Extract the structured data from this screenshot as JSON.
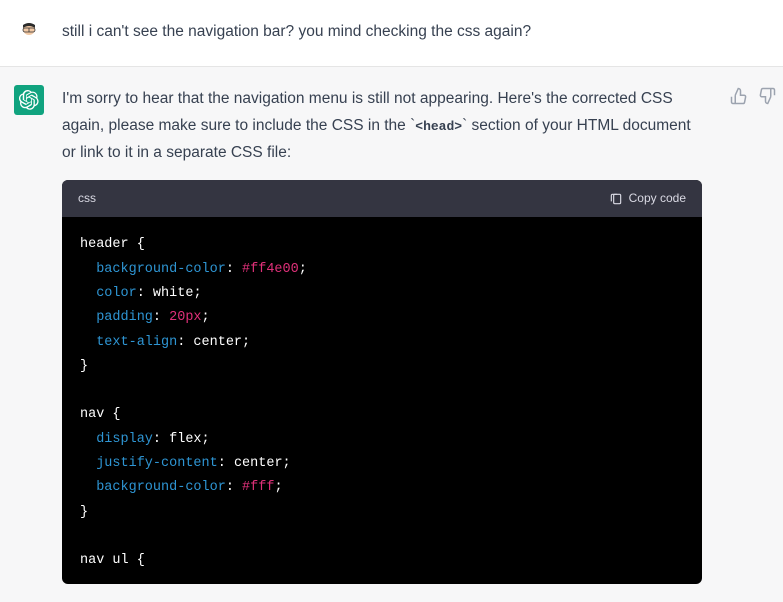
{
  "user_message": "still i can't see the navigation bar? you mind checking the css again?",
  "assistant_message": {
    "part1": "I'm sorry to hear that the navigation menu is still not appearing. Here's the corrected CSS again, please make sure to include the CSS in the `",
    "inline_code": "<head>",
    "part2": "` section of your HTML document or link to it in a separate CSS file:"
  },
  "code": {
    "lang": "css",
    "copy_label": "Copy code",
    "lines": [
      {
        "t": "sel",
        "v": "header {"
      },
      {
        "t": "decl",
        "prop": "background-color",
        "val": "#ff4e00",
        "valtype": "hex"
      },
      {
        "t": "decl",
        "prop": "color",
        "val": "white",
        "valtype": "kw"
      },
      {
        "t": "decl",
        "prop": "padding",
        "val": "20px",
        "valtype": "num"
      },
      {
        "t": "decl",
        "prop": "text-align",
        "val": "center",
        "valtype": "kw"
      },
      {
        "t": "sel",
        "v": "}"
      },
      {
        "t": "blank"
      },
      {
        "t": "sel",
        "v": "nav {"
      },
      {
        "t": "decl",
        "prop": "display",
        "val": "flex",
        "valtype": "kw"
      },
      {
        "t": "decl",
        "prop": "justify-content",
        "val": "center",
        "valtype": "kw"
      },
      {
        "t": "decl",
        "prop": "background-color",
        "val": "#fff",
        "valtype": "hex"
      },
      {
        "t": "sel",
        "v": "}"
      },
      {
        "t": "blank"
      },
      {
        "t": "sel",
        "v": "nav ul {"
      }
    ]
  }
}
